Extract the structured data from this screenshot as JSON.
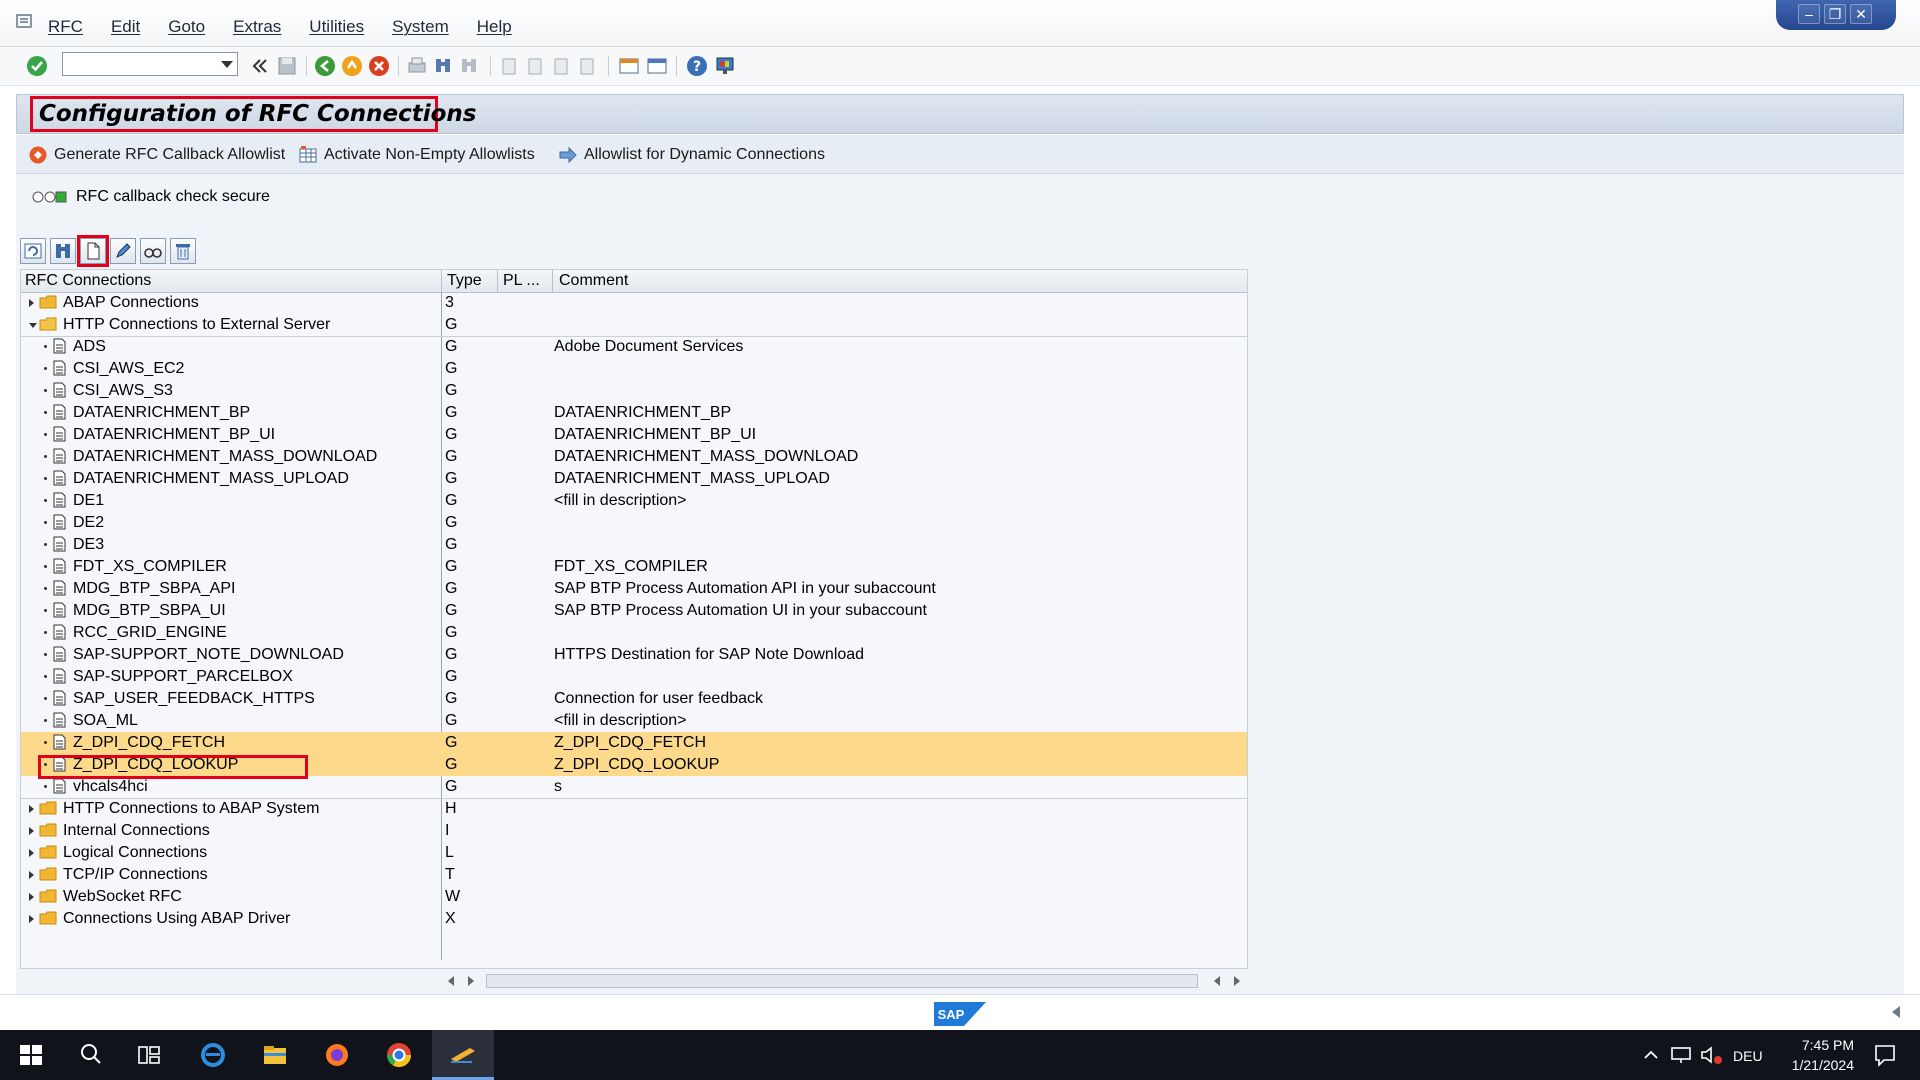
{
  "menu": {
    "items": [
      "RFC",
      "Edit",
      "Goto",
      "Extras",
      "Utilities",
      "System",
      "Help"
    ]
  },
  "toolbar": {
    "command_field_value": ""
  },
  "title": "Configuration of RFC Connections",
  "app_toolbar": {
    "generate_allowlist": "Generate RFC Callback Allowlist",
    "activate_allowlists": "Activate Non-Empty Allowlists",
    "dynamic_allowlist": "Allowlist for Dynamic Connections"
  },
  "status": {
    "callback_check": "RFC callback check secure"
  },
  "grid": {
    "columns": {
      "name": "RFC Connections",
      "type": "Type",
      "pl": "PL ...",
      "comment": "Comment"
    },
    "rows": [
      {
        "name": "ABAP Connections",
        "type": "3",
        "comment": ""
      },
      {
        "name": "HTTP Connections to External Server",
        "type": "G",
        "comment": ""
      },
      {
        "name": "ADS",
        "type": "G",
        "comment": "Adobe Document Services"
      },
      {
        "name": "CSI_AWS_EC2",
        "type": "G",
        "comment": ""
      },
      {
        "name": "CSI_AWS_S3",
        "type": "G",
        "comment": ""
      },
      {
        "name": "DATAENRICHMENT_BP",
        "type": "G",
        "comment": "DATAENRICHMENT_BP"
      },
      {
        "name": "DATAENRICHMENT_BP_UI",
        "type": "G",
        "comment": "DATAENRICHMENT_BP_UI"
      },
      {
        "name": "DATAENRICHMENT_MASS_DOWNLOAD",
        "type": "G",
        "comment": "DATAENRICHMENT_MASS_DOWNLOAD"
      },
      {
        "name": "DATAENRICHMENT_MASS_UPLOAD",
        "type": "G",
        "comment": "DATAENRICHMENT_MASS_UPLOAD"
      },
      {
        "name": "DE1",
        "type": "G",
        "comment": "<fill in description>"
      },
      {
        "name": "DE2",
        "type": "G",
        "comment": ""
      },
      {
        "name": "DE3",
        "type": "G",
        "comment": ""
      },
      {
        "name": "FDT_XS_COMPILER",
        "type": "G",
        "comment": "FDT_XS_COMPILER"
      },
      {
        "name": "MDG_BTP_SBPA_API",
        "type": "G",
        "comment": "SAP BTP Process Automation API in your subaccount"
      },
      {
        "name": "MDG_BTP_SBPA_UI",
        "type": "G",
        "comment": "SAP BTP Process Automation UI in your subaccount"
      },
      {
        "name": "RCC_GRID_ENGINE",
        "type": "G",
        "comment": ""
      },
      {
        "name": "SAP-SUPPORT_NOTE_DOWNLOAD",
        "type": "G",
        "comment": "HTTPS Destination for SAP Note Download"
      },
      {
        "name": "SAP-SUPPORT_PARCELBOX",
        "type": "G",
        "comment": ""
      },
      {
        "name": "SAP_USER_FEEDBACK_HTTPS",
        "type": "G",
        "comment": "Connection for user feedback"
      },
      {
        "name": "SOA_ML",
        "type": "G",
        "comment": "<fill in description>"
      },
      {
        "name": "Z_DPI_CDQ_FETCH",
        "type": "G",
        "comment": "Z_DPI_CDQ_FETCH"
      },
      {
        "name": "Z_DPI_CDQ_LOOKUP",
        "type": "G",
        "comment": "Z_DPI_CDQ_LOOKUP"
      },
      {
        "name": "vhcals4hci",
        "type": "G",
        "comment": "s"
      },
      {
        "name": "HTTP Connections to ABAP System",
        "type": "H",
        "comment": ""
      },
      {
        "name": "Internal Connections",
        "type": "I",
        "comment": ""
      },
      {
        "name": "Logical Connections",
        "type": "L",
        "comment": ""
      },
      {
        "name": "TCP/IP Connections",
        "type": "T",
        "comment": ""
      },
      {
        "name": "WebSocket RFC",
        "type": "W",
        "comment": ""
      },
      {
        "name": "Connections Using ABAP Driver",
        "type": "X",
        "comment": ""
      }
    ]
  },
  "footer": {
    "logo_text": "SAP"
  },
  "taskbar": {
    "language": "DEU",
    "time": "7:45 PM",
    "date": "1/21/2024"
  },
  "colors": {
    "highlight_row": "#fcd98b",
    "annotation_red": "#e3001b",
    "title_bar": "#cdd8e5"
  }
}
